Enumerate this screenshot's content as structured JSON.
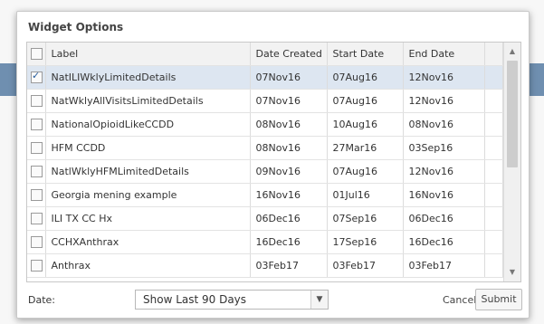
{
  "dialog": {
    "title": "Widget Options"
  },
  "grid": {
    "columns": [
      "Label",
      "Date Created",
      "Start Date",
      "End Date"
    ],
    "rows": [
      {
        "label": "NatILIWklyLimitedDetails",
        "created": "07Nov16",
        "start": "07Aug16",
        "end": "12Nov16",
        "checked": true
      },
      {
        "label": "NatWklyAllVisitsLimitedDetails",
        "created": "07Nov16",
        "start": "07Aug16",
        "end": "12Nov16",
        "checked": false
      },
      {
        "label": "NationalOpioidLikeCCDD",
        "created": "08Nov16",
        "start": "10Aug16",
        "end": "08Nov16",
        "checked": false
      },
      {
        "label": "HFM CCDD",
        "created": "08Nov16",
        "start": "27Mar16",
        "end": "03Sep16",
        "checked": false
      },
      {
        "label": "NatlWklyHFMLimitedDetails",
        "created": "09Nov16",
        "start": "07Aug16",
        "end": "12Nov16",
        "checked": false
      },
      {
        "label": "Georgia mening example",
        "created": "16Nov16",
        "start": "01Jul16",
        "end": "16Nov16",
        "checked": false
      },
      {
        "label": "ILI TX CC Hx",
        "created": "06Dec16",
        "start": "07Sep16",
        "end": "06Dec16",
        "checked": false
      },
      {
        "label": "CCHXAnthrax",
        "created": "16Dec16",
        "start": "17Sep16",
        "end": "16Dec16",
        "checked": false
      },
      {
        "label": "Anthrax",
        "created": "03Feb17",
        "start": "03Feb17",
        "end": "03Feb17",
        "checked": false
      }
    ]
  },
  "footer": {
    "date_label": "Date:",
    "date_select_value": "Show Last 90 Days",
    "cancel_label": "Cancel",
    "submit_label": "Submit"
  },
  "colors": {
    "selected_row": "#dde6f1",
    "background_band": "#6f8fb0"
  }
}
